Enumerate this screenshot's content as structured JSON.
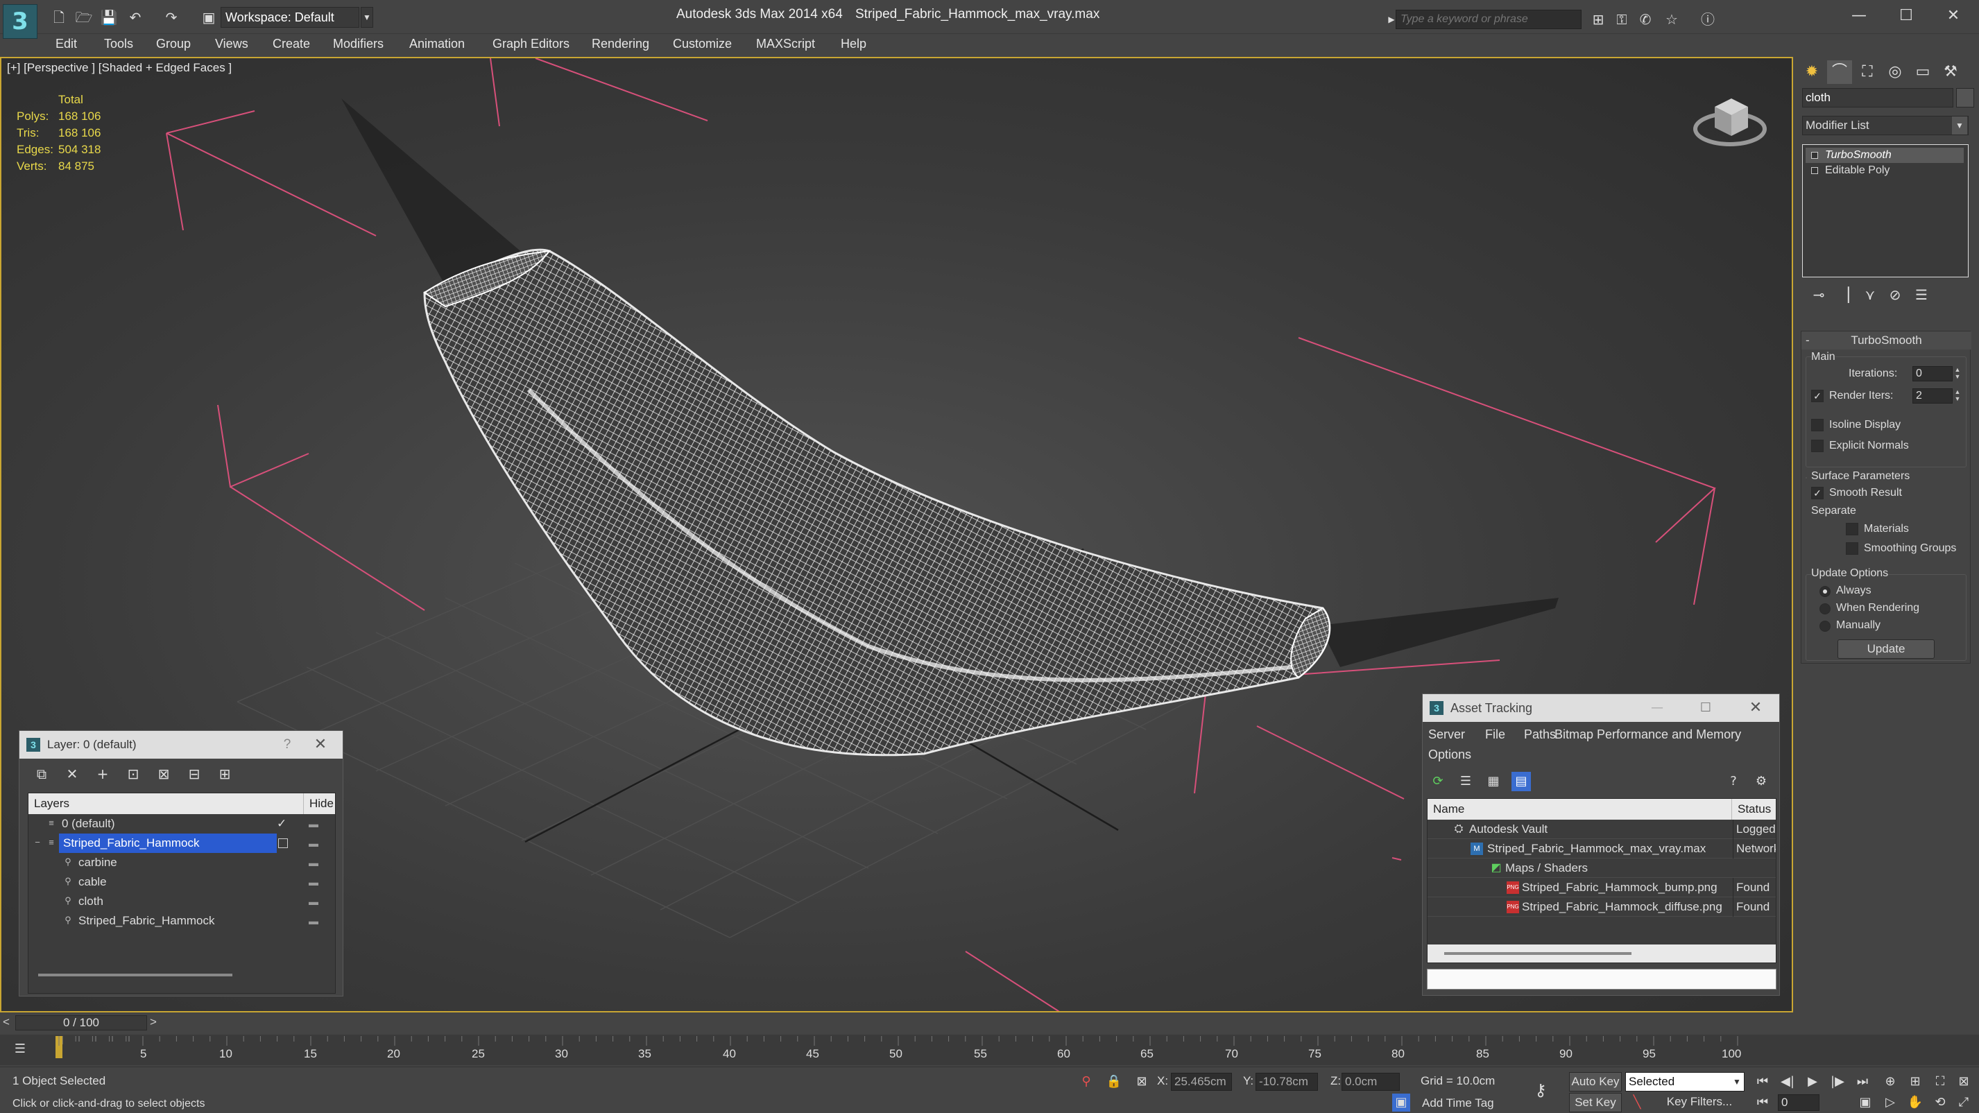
{
  "titlebar": {
    "workspace": "Workspace: Default",
    "app_title": "Autodesk 3ds Max  2014 x64",
    "file_title": "Striped_Fabric_Hammock_max_vray.max",
    "search_placeholder": "Type a keyword or phrase"
  },
  "menu": [
    "Edit",
    "Tools",
    "Group",
    "Views",
    "Create",
    "Modifiers",
    "Animation",
    "Graph Editors",
    "Rendering",
    "Customize",
    "MAXScript",
    "Help"
  ],
  "viewport": {
    "label": "[+] [Perspective ] [Shaded + Edged Faces ]",
    "stats": {
      "header": "Total",
      "rows": [
        {
          "label": "Polys:",
          "value": "168 106"
        },
        {
          "label": "Tris:",
          "value": "168 106"
        },
        {
          "label": "Edges:",
          "value": "504 318"
        },
        {
          "label": "Verts:",
          "value": "84 875"
        }
      ]
    }
  },
  "command_panel": {
    "object_name": "cloth",
    "modifier_list": "Modifier List",
    "stack": [
      "TurboSmooth",
      "Editable Poly"
    ],
    "turbosmooth": {
      "title": "TurboSmooth",
      "main_label": "Main",
      "iterations_label": "Iterations:",
      "iterations_value": "0",
      "render_iters_label": "Render Iters:",
      "render_iters_value": "2",
      "isoline": "Isoline Display",
      "explicit_normals": "Explicit Normals",
      "surface_params": "Surface Parameters",
      "smooth_result": "Smooth Result",
      "separate": "Separate",
      "materials": "Materials",
      "smoothing_groups": "Smoothing Groups",
      "update_options": "Update Options",
      "always": "Always",
      "when_rendering": "When Rendering",
      "manually": "Manually",
      "update_button": "Update"
    }
  },
  "layer_dialog": {
    "title": "Layer: 0 (default)",
    "help": "?",
    "col_layers": "Layers",
    "col_hide": "Hide",
    "rows": [
      {
        "name": "0 (default)",
        "indent": 0,
        "check": "✓"
      },
      {
        "name": "Striped_Fabric_Hammock",
        "indent": 0,
        "selected": true
      },
      {
        "name": "carbine",
        "indent": 1
      },
      {
        "name": "cable",
        "indent": 1
      },
      {
        "name": "cloth",
        "indent": 1
      },
      {
        "name": "Striped_Fabric_Hammock",
        "indent": 1
      }
    ]
  },
  "asset_dialog": {
    "title": "Asset Tracking",
    "menu": [
      "Server",
      "File",
      "Paths",
      "Bitmap Performance and Memory",
      "Options"
    ],
    "col_name": "Name",
    "col_status": "Status",
    "rows": [
      {
        "name": "Autodesk Vault",
        "status": "Logged",
        "indent": 1
      },
      {
        "name": "Striped_Fabric_Hammock_max_vray.max",
        "status": "Network",
        "indent": 2
      },
      {
        "name": "Maps / Shaders",
        "status": "",
        "indent": 3
      },
      {
        "name": "Striped_Fabric_Hammock_bump.png",
        "status": "Found",
        "indent": 4
      },
      {
        "name": "Striped_Fabric_Hammock_diffuse.png",
        "status": "Found",
        "indent": 4
      }
    ]
  },
  "timeline": {
    "slider": "0 / 100",
    "ticks": [
      "5",
      "10",
      "15",
      "20",
      "25",
      "30",
      "35",
      "40",
      "45",
      "50",
      "55",
      "60",
      "65",
      "70",
      "75",
      "80",
      "85",
      "90",
      "95",
      "100"
    ]
  },
  "status": {
    "selection": "1 Object Selected",
    "prompt": "Click or click-and-drag to select objects",
    "x_label": "X:",
    "x_value": "25.465cm",
    "y_label": "Y:",
    "y_value": "-10.78cm",
    "z_label": "Z:",
    "z_value": "0.0cm",
    "grid": "Grid = 10.0cm",
    "add_time_tag": "Add Time Tag",
    "auto_key": "Auto Key",
    "set_key": "Set Key",
    "selected": "Selected",
    "key_filters": "Key Filters...",
    "frame": "0"
  },
  "colors": {
    "accent": "#c9a632",
    "stats": "#e8d84a",
    "selection": "#2a5bd0",
    "light_lines": "#d7507a"
  }
}
